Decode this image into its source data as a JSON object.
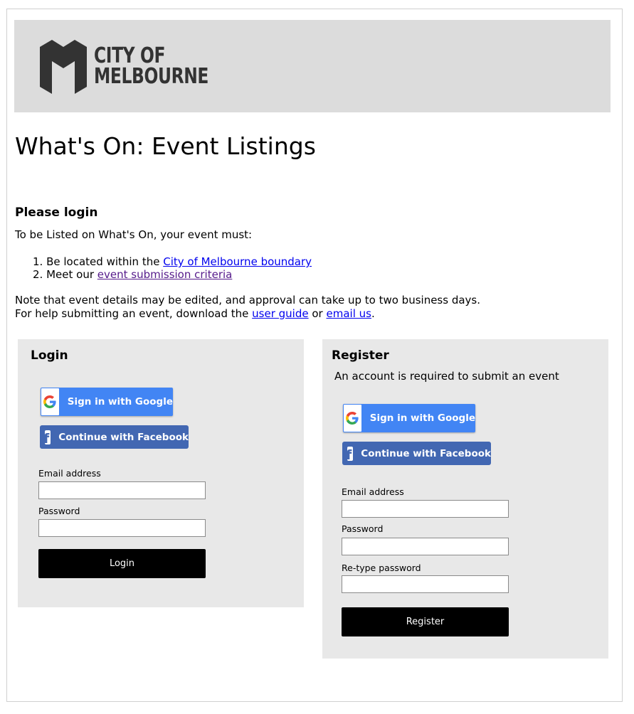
{
  "header": {
    "logo_line1": "CITY OF",
    "logo_line2": "MELBOURNE"
  },
  "page_title": "What's On: Event Listings",
  "intro": {
    "heading": "Please login",
    "lead": "To be Listed on What's On, your event must:",
    "requirements": [
      {
        "number": "1.",
        "text": "Be located within the ",
        "link": "City of Melbourne boundary"
      },
      {
        "number": "2.",
        "text": "Meet our ",
        "link": "event submission criteria"
      }
    ],
    "note_line1": "Note that event details may be edited, and approval can take up to two business days.",
    "help_prefix": "For help submitting an event, download the ",
    "help_link1": "user guide",
    "help_mid": " or ",
    "help_link2": "email us",
    "help_suffix": "."
  },
  "login": {
    "title": "Login",
    "google_label": "Sign in with Google",
    "facebook_label": "Continue with Facebook",
    "email_label": "Email address",
    "email_value": "",
    "password_label": "Password",
    "password_value": "",
    "submit_label": "Login"
  },
  "register": {
    "title": "Register",
    "subtitle": "An account is required to submit an event",
    "google_label": "Sign in with Google",
    "facebook_label": "Continue with Facebook",
    "email_label": "Email address",
    "email_value": "",
    "password_label": "Password",
    "password_value": "",
    "retype_label": "Re-type password",
    "retype_value": "",
    "submit_label": "Register"
  },
  "colors": {
    "google_blue": "#4285f4",
    "facebook_blue": "#4267b2",
    "panel_bg": "#e8e8e8",
    "header_bg": "#dcdcdc",
    "link": "#0000ee",
    "visited_link": "#551a8b"
  },
  "icons": {
    "google": "google-g-icon",
    "facebook": "facebook-f-icon",
    "logo": "city-of-melbourne-m-logo"
  }
}
